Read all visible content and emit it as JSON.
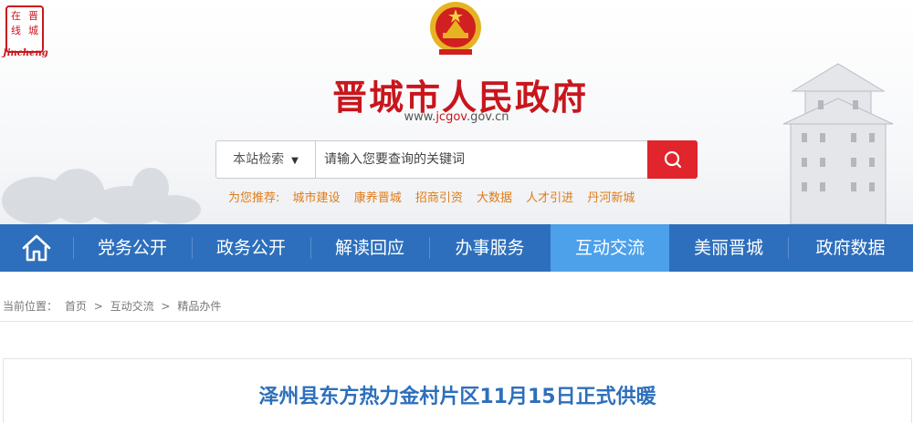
{
  "logo": {
    "chars": [
      "在",
      "晋",
      "线",
      "城"
    ],
    "sub": "Jincheng"
  },
  "site": {
    "title": "晋城市人民政府",
    "url_prefix": "www.",
    "url_domain": "jcgov",
    "url_suffix": ".gov.cn"
  },
  "search": {
    "scope": "本站检索",
    "placeholder": "请输入您要查询的关键词",
    "value": ""
  },
  "recommend": {
    "label": "为您推荐:",
    "items": [
      "城市建设",
      "康养晋城",
      "招商引资",
      "大数据",
      "人才引进",
      "丹河新城"
    ]
  },
  "nav": {
    "items": [
      "党务公开",
      "政务公开",
      "解读回应",
      "办事服务",
      "互动交流",
      "美丽晋城",
      "政府数据"
    ],
    "active": "互动交流"
  },
  "breadcrumb": {
    "label": "当前位置：",
    "items": [
      "首页",
      "互动交流",
      "精品办件"
    ],
    "sep": ">"
  },
  "article": {
    "title": "泽州县东方热力金村片区11月15日正式供暖"
  },
  "colors": {
    "brand_red": "#c8161d",
    "nav_blue": "#2d6fbc",
    "nav_active": "#4da0ea",
    "recommend_orange": "#e07b16"
  }
}
